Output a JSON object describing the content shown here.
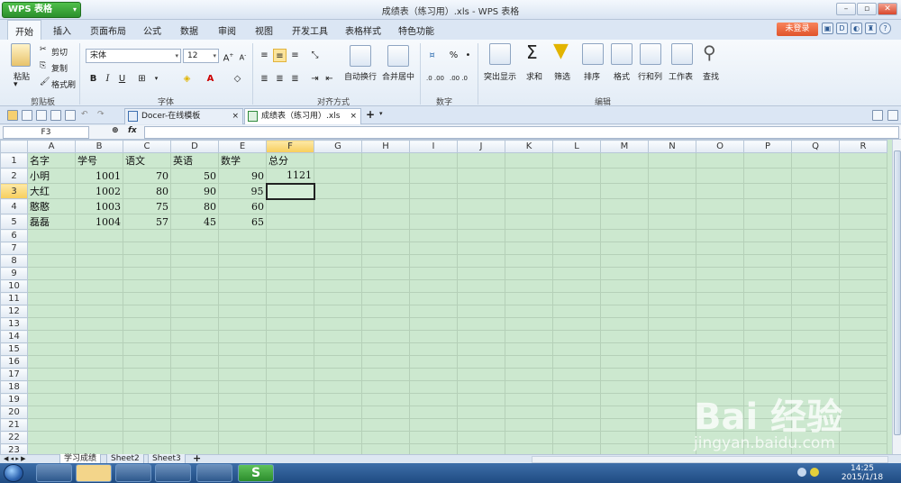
{
  "window": {
    "app_button": "WPS 表格",
    "title": "成绩表（练习用）.xls - WPS 表格"
  },
  "menu": {
    "items": [
      "开始",
      "插入",
      "页面布局",
      "公式",
      "数据",
      "审阅",
      "视图",
      "开发工具",
      "表格样式",
      "特色功能"
    ],
    "login": "未登录"
  },
  "ribbon": {
    "clipboard": {
      "paste": "粘贴",
      "cut": "剪切",
      "copy": "复制",
      "format_painter": "格式刷",
      "group": "剪贴板"
    },
    "font": {
      "name": "宋体",
      "size": "12",
      "bold": "B",
      "italic": "I",
      "underline": "U",
      "group": "字体"
    },
    "align": {
      "wrap": "自动换行",
      "merge": "合并居中",
      "group": "对齐方式"
    },
    "number": {
      "percent": "%",
      "group": "数字",
      "inc": ".0 .00",
      "dec": ".00 .0"
    },
    "edit": {
      "highlight": "突出显示",
      "sum": "求和",
      "filter": "筛选",
      "sort": "排序",
      "format": "格式",
      "rowcol": "行和列",
      "sheet": "工作表",
      "find": "查找",
      "group": "编辑"
    }
  },
  "tabs": {
    "docer": "Docer-在线模板",
    "file": "成绩表（练习用）.xls",
    "add": "+"
  },
  "formula": {
    "cell_ref": "F3",
    "fx": "fx",
    "value": ""
  },
  "grid": {
    "columns": [
      "A",
      "B",
      "C",
      "D",
      "E",
      "F",
      "G",
      "H",
      "I",
      "J",
      "K",
      "L",
      "M",
      "N",
      "O",
      "P",
      "Q",
      "R"
    ],
    "active_col": "F",
    "active_row": 3,
    "row_count": 24,
    "rows": [
      [
        "名字",
        "学号",
        "语文",
        "英语",
        "数学",
        "总分"
      ],
      [
        "小明",
        "1001",
        "70",
        "50",
        "90",
        "1121"
      ],
      [
        "大红",
        "1002",
        "80",
        "90",
        "95",
        ""
      ],
      [
        "憨憨",
        "1003",
        "75",
        "80",
        "60",
        ""
      ],
      [
        "磊磊",
        "1004",
        "57",
        "45",
        "65",
        ""
      ]
    ]
  },
  "sheets": [
    "学习成绩",
    "Sheet2",
    "Sheet3"
  ],
  "taskbar": {
    "time": "14:25",
    "date": "2015/1/18"
  },
  "watermark": {
    "logo": "Bai 经验",
    "url": "jingyan.baidu.com"
  }
}
